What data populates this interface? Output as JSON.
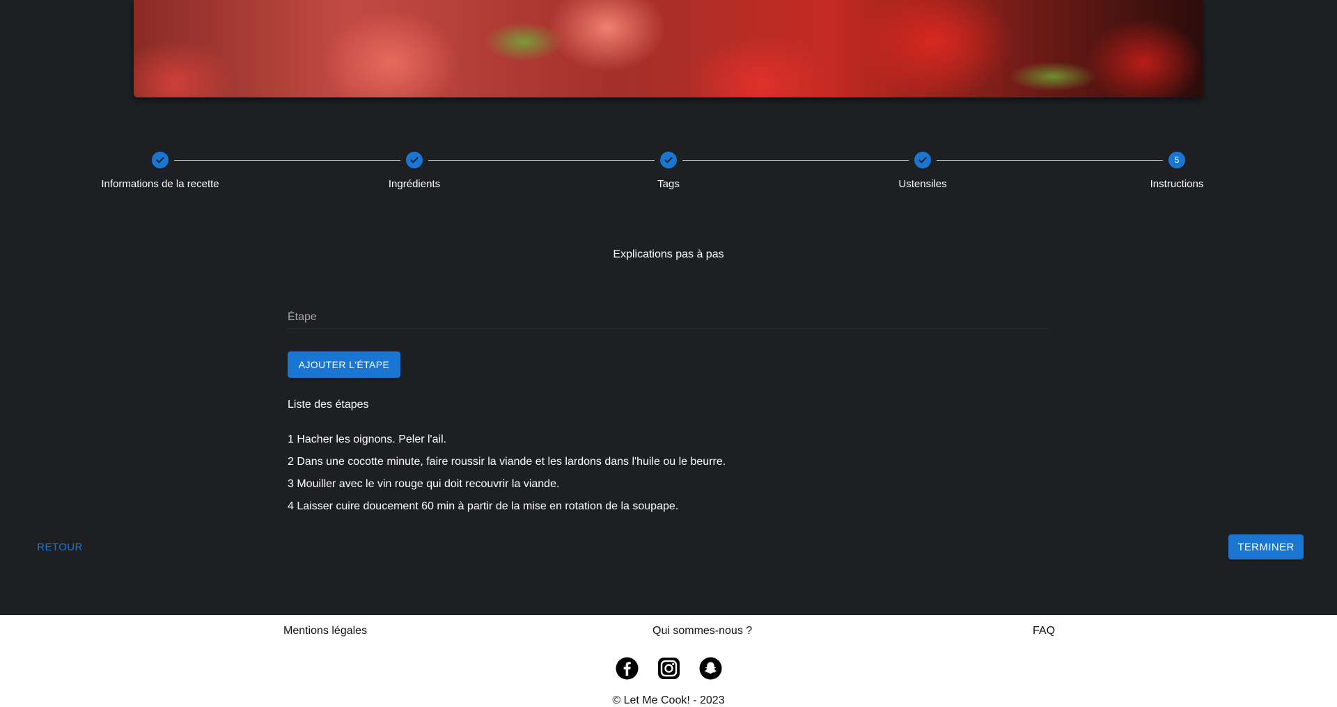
{
  "stepper": {
    "steps": [
      {
        "label": "Informations de la recette",
        "state": "done",
        "icon": "check-icon"
      },
      {
        "label": "Ingrédients",
        "state": "done",
        "icon": "check-icon"
      },
      {
        "label": "Tags",
        "state": "done",
        "icon": "check-icon"
      },
      {
        "label": "Ustensiles",
        "state": "done",
        "icon": "check-icon"
      },
      {
        "label": "Instructions",
        "state": "active",
        "number": "5"
      }
    ]
  },
  "form": {
    "section_title": "Explications pas à pas",
    "step_input": {
      "placeholder": "Étape",
      "value": ""
    },
    "add_button_label": "Ajouter l'étape",
    "list_title": "Liste des étapes",
    "steps": [
      "1 Hacher les oignons. Peler l'ail.",
      "2 Dans une cocotte minute, faire roussir la viande et les lardons dans l'huile ou le beurre.",
      "3 Mouiller avec le vin rouge qui doit recouvrir la viande.",
      "4 Laisser cuire doucement 60 min à partir de la mise en rotation de la soupape."
    ]
  },
  "nav": {
    "back_label": "Retour",
    "finish_label": "Terminer"
  },
  "footer": {
    "links": [
      "Mentions légales",
      "Qui sommes-nous ?",
      "FAQ"
    ],
    "socials": [
      "facebook-icon",
      "instagram-icon",
      "snapchat-icon"
    ],
    "copyright": "© Let Me Cook! - 2023"
  },
  "colors": {
    "background": "#1d1f23",
    "accent": "#1976d2",
    "footer_bg": "#ffffff"
  }
}
